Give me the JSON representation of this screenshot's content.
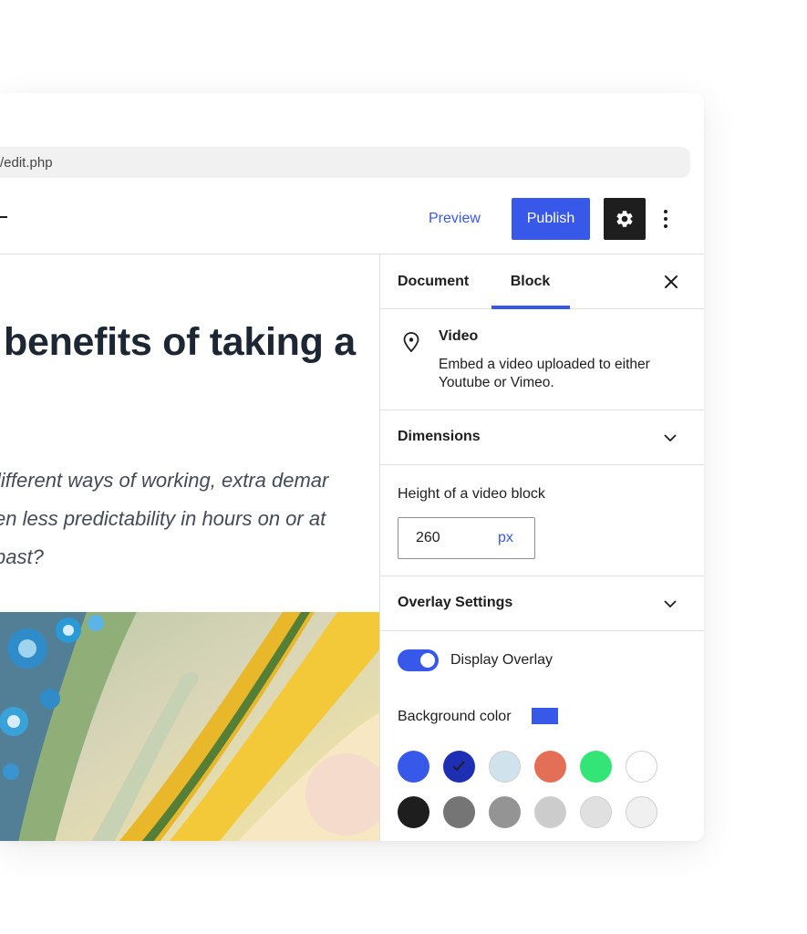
{
  "browser": {
    "url": "/edit.php"
  },
  "toolbar": {
    "preview_label": "Preview",
    "publish_label": "Publish",
    "settings_icon": "gear-icon",
    "more_icon": "more-vertical-icon"
  },
  "editor": {
    "title": "benefits of taking a",
    "excerpt_lines": [
      "lifferent ways of working, extra demar",
      "en less predictability in hours on or at",
      " past?"
    ]
  },
  "sidebar": {
    "tabs": [
      {
        "label": "Document"
      },
      {
        "label": "Block"
      }
    ],
    "active_tab": "Block",
    "close_icon": "close-icon",
    "block": {
      "icon": "location-pin-icon",
      "name": "Video",
      "description": "Embed a video uploaded to either Youtube or Vimeo."
    },
    "dimensions": {
      "title": "Dimensions",
      "height_label": "Height of a video block",
      "height_value": "260",
      "height_unit": "px"
    },
    "overlay": {
      "title": "Overlay Settings",
      "display_overlay_label": "Display Overlay",
      "display_overlay_on": true,
      "bg_color_label": "Background color",
      "bg_color": "#3858e9",
      "palette": [
        "#3858e9",
        "#1f2fb3",
        "#d0e3ec",
        "#e26f56",
        "#33e476",
        "#ffffff",
        "#1e1e1e",
        "#757575",
        "#949494",
        "#cccccc",
        "#e0e0e0",
        "#f0f0f0"
      ],
      "selected_index": 1
    }
  },
  "colors": {
    "accent": "#3858e9",
    "text": "#1e1e1e",
    "border": "#e0e0e0"
  }
}
